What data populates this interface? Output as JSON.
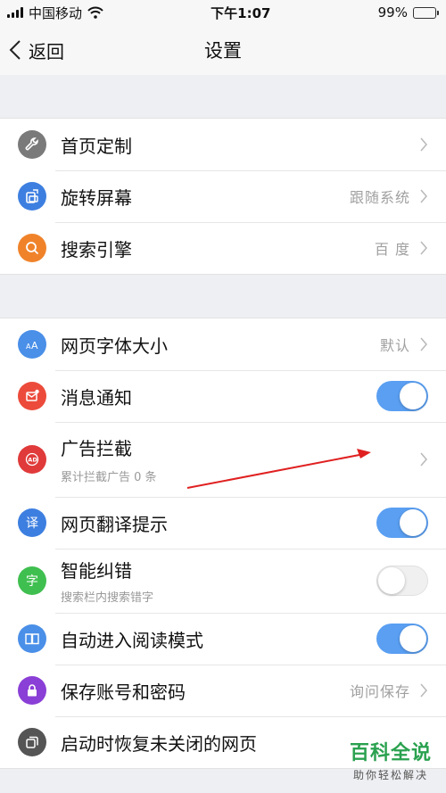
{
  "status": {
    "carrier": "中国移动",
    "time": "下午1:07",
    "battery": "99%",
    "battery_level": 0.99
  },
  "nav": {
    "back_label": "返回",
    "title": "设置"
  },
  "section1": [
    {
      "label": "首页定制",
      "value": "",
      "icon": "wrench-icon",
      "color": "#7a7a7a"
    },
    {
      "label": "旋转屏幕",
      "value": "跟随系统",
      "icon": "rotate-screen-icon",
      "color": "#3d7fe0"
    },
    {
      "label": "搜索引擎",
      "value": "百 度",
      "icon": "search-icon",
      "color": "#f0832a"
    }
  ],
  "section2": [
    {
      "label": "网页字体大小",
      "value": "默认",
      "icon": "font-size-icon",
      "color": "#4a8fe8"
    },
    {
      "label": "消息通知",
      "toggle": true,
      "icon": "message-icon",
      "color": "#ec4b3b"
    },
    {
      "label": "广告拦截",
      "sub": "累计拦截广告 0 条",
      "icon": "ad-block-icon",
      "color": "#e03a3a"
    },
    {
      "label": "网页翻译提示",
      "toggle": true,
      "icon": "translate-icon",
      "icon_text": "译",
      "color": "#3d7fe0"
    },
    {
      "label": "智能纠错",
      "sub": "搜索栏内搜索错字",
      "toggle": false,
      "icon": "correction-icon",
      "icon_text": "字",
      "color": "#3fbf4f"
    },
    {
      "label": "自动进入阅读模式",
      "toggle": true,
      "icon": "book-icon",
      "color": "#4a8fe8"
    },
    {
      "label": "保存账号和密码",
      "value": "询问保存",
      "icon": "lock-icon",
      "color": "#8a3fd6"
    },
    {
      "label": "启动时恢复未关闭的网页",
      "icon": "windows-icon",
      "color": "#555555"
    }
  ],
  "watermark": {
    "title": "百科全说",
    "subtitle": "助你轻松解决"
  }
}
